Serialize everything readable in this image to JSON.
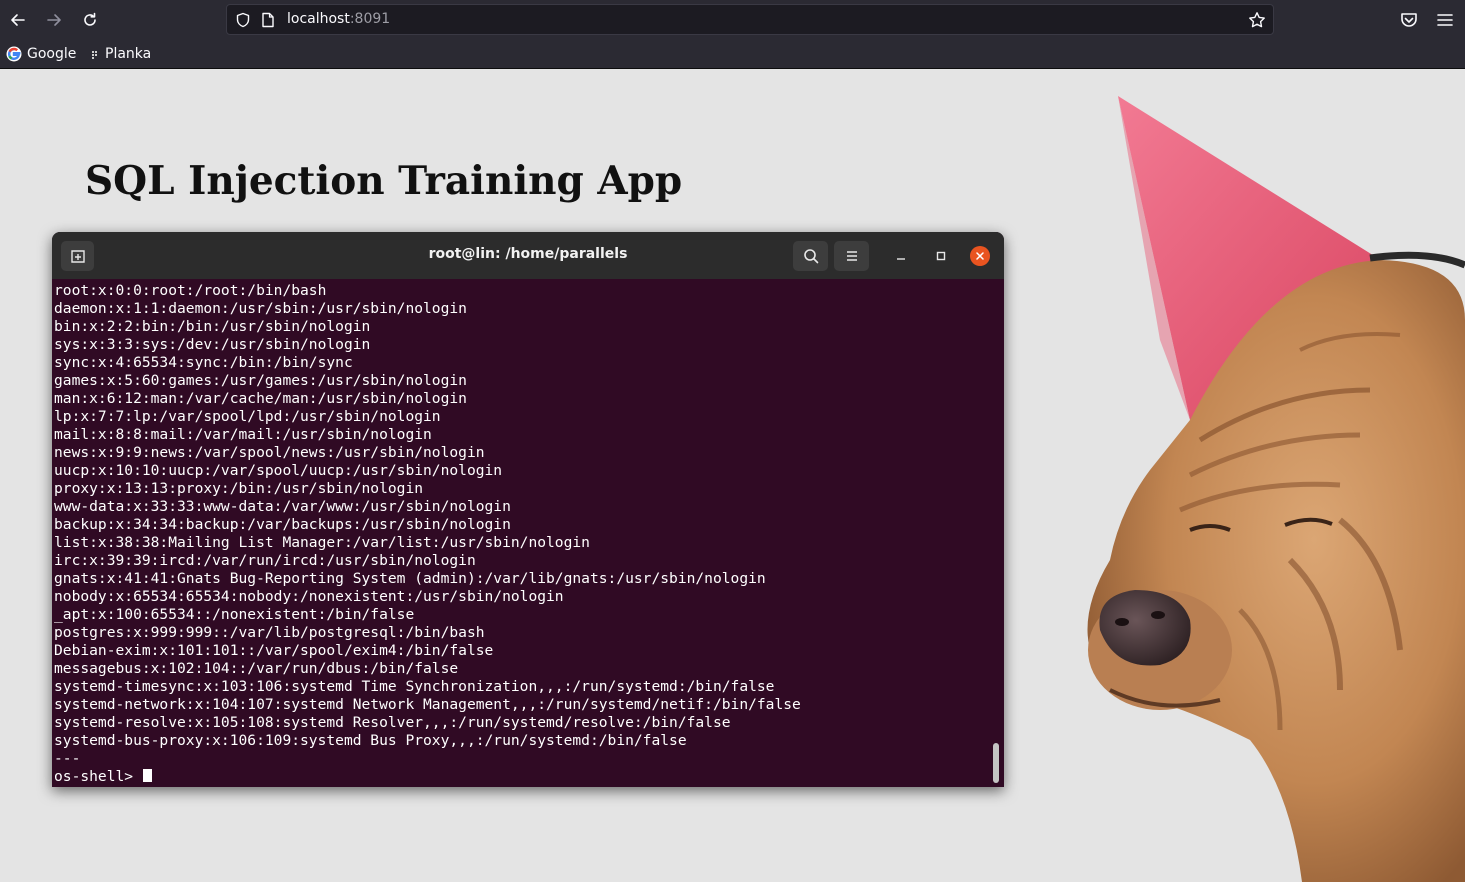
{
  "browser": {
    "url_host": "localhost",
    "url_port": ":8091",
    "bookmarks": [
      {
        "label": "Google",
        "icon": "google-icon"
      },
      {
        "label": "Planka",
        "icon": "planka-icon"
      }
    ]
  },
  "page": {
    "title": "SQL Injection Training App"
  },
  "terminal": {
    "title": "root@lin: /home/parallels",
    "lines": [
      "root:x:0:0:root:/root:/bin/bash",
      "daemon:x:1:1:daemon:/usr/sbin:/usr/sbin/nologin",
      "bin:x:2:2:bin:/bin:/usr/sbin/nologin",
      "sys:x:3:3:sys:/dev:/usr/sbin/nologin",
      "sync:x:4:65534:sync:/bin:/bin/sync",
      "games:x:5:60:games:/usr/games:/usr/sbin/nologin",
      "man:x:6:12:man:/var/cache/man:/usr/sbin/nologin",
      "lp:x:7:7:lp:/var/spool/lpd:/usr/sbin/nologin",
      "mail:x:8:8:mail:/var/mail:/usr/sbin/nologin",
      "news:x:9:9:news:/var/spool/news:/usr/sbin/nologin",
      "uucp:x:10:10:uucp:/var/spool/uucp:/usr/sbin/nologin",
      "proxy:x:13:13:proxy:/bin:/usr/sbin/nologin",
      "www-data:x:33:33:www-data:/var/www:/usr/sbin/nologin",
      "backup:x:34:34:backup:/var/backups:/usr/sbin/nologin",
      "list:x:38:38:Mailing List Manager:/var/list:/usr/sbin/nologin",
      "irc:x:39:39:ircd:/var/run/ircd:/usr/sbin/nologin",
      "gnats:x:41:41:Gnats Bug-Reporting System (admin):/var/lib/gnats:/usr/sbin/nologin",
      "nobody:x:65534:65534:nobody:/nonexistent:/usr/sbin/nologin",
      "_apt:x:100:65534::/nonexistent:/bin/false",
      "postgres:x:999:999::/var/lib/postgresql:/bin/bash",
      "Debian-exim:x:101:101::/var/spool/exim4:/bin/false",
      "messagebus:x:102:104::/var/run/dbus:/bin/false",
      "systemd-timesync:x:103:106:systemd Time Synchronization,,,:/run/systemd:/bin/false",
      "systemd-network:x:104:107:systemd Network Management,,,:/run/systemd/netif:/bin/false",
      "systemd-resolve:x:105:108:systemd Resolver,,,:/run/systemd/resolve:/bin/false",
      "systemd-bus-proxy:x:106:109:systemd Bus Proxy,,,:/run/systemd:/bin/false",
      "---"
    ],
    "prompt": "os-shell> "
  },
  "colors": {
    "terminal_bg": "#300a24",
    "close_button": "#e95420",
    "browser_chrome": "#2b2a33",
    "page_bg": "#e4e4e4"
  }
}
